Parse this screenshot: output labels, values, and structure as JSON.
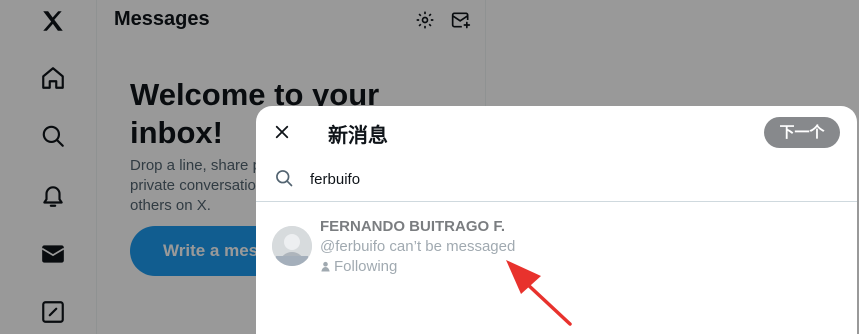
{
  "sidebar": {
    "items": [
      {
        "icon": "x-logo-icon"
      },
      {
        "icon": "home-icon"
      },
      {
        "icon": "search-icon"
      },
      {
        "icon": "bell-icon"
      },
      {
        "icon": "mail-icon"
      },
      {
        "icon": "compose-icon"
      }
    ]
  },
  "messages": {
    "title": "Messages",
    "welcome_title": "Welcome to your inbox!",
    "welcome_desc": "Drop a line, share posts and more with private conversations between you and others on X.",
    "write_button": "Write a message"
  },
  "modal": {
    "title": "新消息",
    "next_button": "下一个",
    "search_value": "ferbuifo",
    "result": {
      "name": "FERNANDO BUITRAGO F.",
      "handle_status": "@ferbuifo can’t be messaged",
      "following": "Following"
    }
  },
  "colors": {
    "accent": "#1d9bf0",
    "overlay": "rgba(0,0,0,0.4)",
    "annotation_arrow": "#e8322d"
  }
}
